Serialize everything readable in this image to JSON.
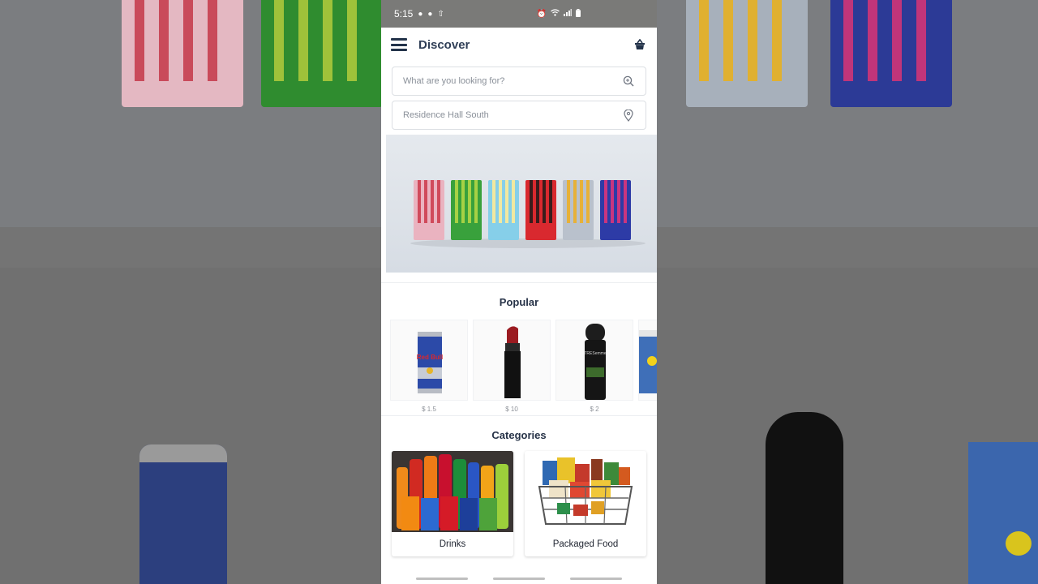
{
  "status_bar": {
    "time": "5:15"
  },
  "app_bar": {
    "title": "Discover"
  },
  "search": {
    "placeholder": "What are you looking for?"
  },
  "location": {
    "value": "Residence Hall South"
  },
  "popular": {
    "title": "Popular",
    "items": [
      {
        "icon": "energy-drink-can",
        "price": "$ 1.5"
      },
      {
        "icon": "lipstick",
        "price": "$ 10"
      },
      {
        "icon": "hairspray-can",
        "price": "$ 2"
      },
      {
        "icon": "chips-bag",
        "price": ""
      }
    ]
  },
  "categories": {
    "title": "Categories",
    "items": [
      {
        "label": "Drinks",
        "icon": "drinks-photo"
      },
      {
        "label": "Packaged Food",
        "icon": "food-basket-photo"
      }
    ]
  },
  "colors": {
    "brand_text": "#2f3e56",
    "status_bar": "#7a7a78",
    "pack_colors": [
      "#e9a7b6",
      "#3aa03c",
      "#7cc7e6",
      "#d62a2f",
      "#b6bec9",
      "#2c3aa0"
    ]
  }
}
